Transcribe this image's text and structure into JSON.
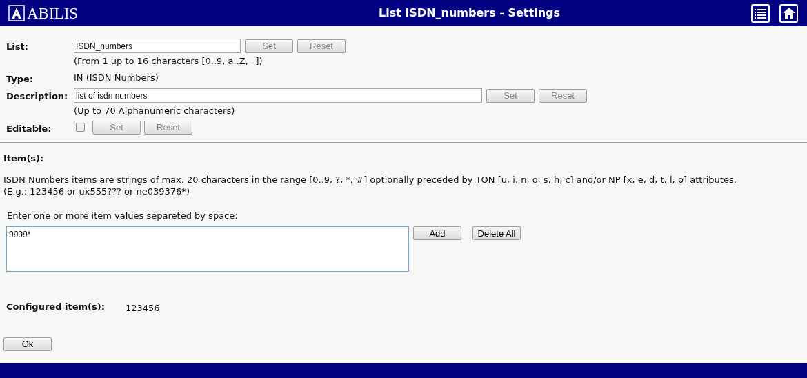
{
  "header": {
    "logo": "ABILIS",
    "title": "List ISDN_numbers - Settings"
  },
  "fields": [
    {
      "kind": "input",
      "label": "List:",
      "value": "ISDN_numbers",
      "hint": "(From 1 up to 16 characters [0..9, a..Z, _])",
      "buttons": [
        {
          "label": "Set",
          "disabled": true
        },
        {
          "label": "Reset",
          "disabled": true
        }
      ]
    },
    {
      "kind": "text",
      "label": "Type:",
      "value": "IN (ISDN Numbers)"
    },
    {
      "kind": "input",
      "label": "Description:",
      "value": "list of isdn numbers",
      "hint": "(Up to 70 Alphanumeric characters)",
      "buttons": [
        {
          "label": "Set",
          "disabled": true
        },
        {
          "label": "Reset",
          "disabled": true
        }
      ]
    },
    {
      "kind": "checkbox",
      "label": "Editable:",
      "checked": false,
      "buttons": [
        {
          "label": "Set",
          "disabled": true
        },
        {
          "label": "Reset",
          "disabled": true
        }
      ]
    }
  ],
  "items": {
    "heading": "Item(s):",
    "description": "ISDN Numbers items are strings of max. 20 characters in the range [0..9, ?, *, #] optionally preceded by TON [u, i, n, o, s, h, c] and/or NP [x, e, d, t, l, p] attributes.",
    "example": "(E.g.: 123456 or ux555??? or ne039376*)",
    "prompt": "Enter one or more item values separeted by space:",
    "entry": "9999*",
    "buttons": [
      {
        "label": "Add",
        "disabled": false
      },
      {
        "label": "Delete All",
        "disabled": false
      }
    ],
    "configured_label": "Configured item(s):",
    "configured": [
      "123456"
    ]
  },
  "ok_button": {
    "label": "Ok",
    "disabled": false
  }
}
